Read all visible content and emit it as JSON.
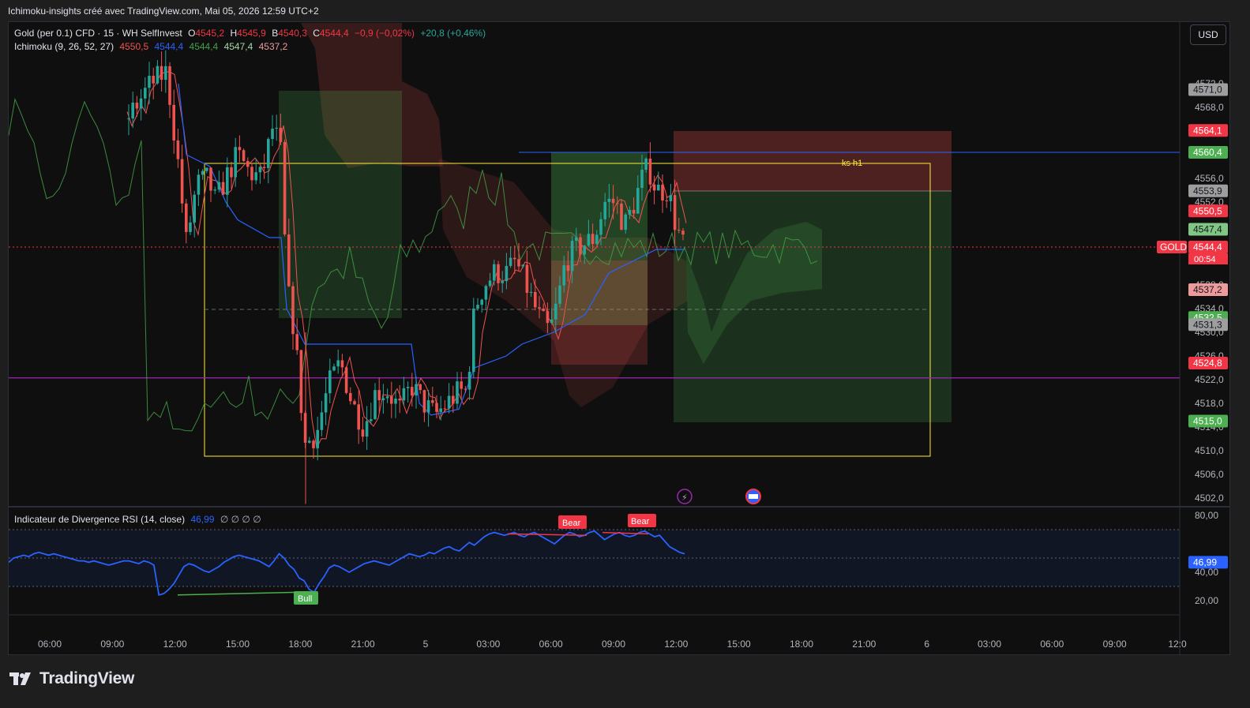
{
  "header": {
    "title": "Ichimoku-insights créé avec TradingView.com, Mai 05, 2026 12:59 UTC+2"
  },
  "currency_button": "USD",
  "legend_main": {
    "symbol": "Gold (per 0.1) CFD · 15 · WH SelfInvest",
    "o_label": "O",
    "o": "4545,2",
    "h_label": "H",
    "h": "4545,9",
    "b_label": "B",
    "b": "4540,3",
    "c_label": "C",
    "c": "4544,4",
    "chg": "−0,9 (−0,02%)",
    "chg2": "+20,8 (+0,46%)"
  },
  "legend_ichimoku": {
    "name": "Ichimoku (9, 26, 52, 27)",
    "v1": "4550,5",
    "v2": "4544,4",
    "v3": "4544,4",
    "v4": "4547,4",
    "v5": "4537,2"
  },
  "legend_rsi": {
    "name": "Indicateur de Divergence RSI (14, close)",
    "value": "46,99",
    "extra": "∅ ∅ ∅ ∅"
  },
  "annotations": {
    "ks": "ks h1",
    "bear": "Bear",
    "bull": "Bull",
    "symbol_tag": "GOLD",
    "countdown": "00:54"
  },
  "brand": "TradingView",
  "colors": {
    "up": "#26a69a",
    "down": "#ef5350",
    "tenkan": "#ef5350",
    "kijun": "#2962ff",
    "chikou": "#43a047",
    "rsi": "#2962ff",
    "purple_line": "#9c27b0",
    "box": "#ffeb3b"
  },
  "chart_data": {
    "type": "candlestick",
    "main": {
      "ylim": [
        4500,
        4576
      ],
      "y_ticks": [
        "4572,0",
        "4568,0",
        "4556,0",
        "4552,0",
        "4538,0",
        "4534,0",
        "4530,0",
        "4526,0",
        "4522,0",
        "4518,0",
        "4514,0",
        "4510,0",
        "4506,0",
        "4502,0"
      ],
      "x_ticks": [
        "06:00",
        "09:00",
        "12:00",
        "15:00",
        "18:00",
        "21:00",
        "5",
        "03:00",
        "06:00",
        "09:00",
        "12:00",
        "15:00",
        "18:00",
        "21:00",
        "6",
        "03:00",
        "06:00",
        "09:00",
        "12:0"
      ],
      "price_labels": [
        {
          "text": "4571,0",
          "color": "#9e9e9e",
          "value": 4571.0
        },
        {
          "text": "4564,1",
          "color": "#f23645",
          "value": 4564.1
        },
        {
          "text": "4560,4",
          "color": "#4caf50",
          "value": 4560.4
        },
        {
          "text": "4553,9",
          "color": "#9e9e9e",
          "value": 4553.9
        },
        {
          "text": "4550,5",
          "color": "#f23645",
          "value": 4550.5
        },
        {
          "text": "4547,4",
          "color": "#81c784",
          "value": 4547.4
        },
        {
          "text": "4544,4",
          "color": "#f23645",
          "value": 4544.4
        },
        {
          "text": "4537,2",
          "color": "#ef9a9a",
          "value": 4537.2
        },
        {
          "text": "4532,5",
          "color": "#4caf50",
          "value": 4532.5
        },
        {
          "text": "4531,3",
          "color": "#9e9e9e",
          "value": 4531.3
        },
        {
          "text": "4524,8",
          "color": "#f23645",
          "value": 4524.8
        },
        {
          "text": "4515,0",
          "color": "#4caf50",
          "value": 4515.0
        }
      ],
      "last_price": 4544.4,
      "horizontal_lines": [
        {
          "name": "ks h1",
          "value": 4560.4,
          "color": "#2962ff"
        },
        {
          "name": "purple",
          "value": 4522.3,
          "color": "#9c27b0"
        }
      ]
    },
    "rsi": {
      "ylim": [
        12,
        82
      ],
      "y_ticks": [
        "80,00",
        "40,00",
        "20,00"
      ],
      "levels": [
        70,
        50,
        30
      ],
      "last": "46,99",
      "values": [
        47,
        50,
        51,
        52,
        51,
        53,
        54,
        53,
        52,
        53,
        52,
        51,
        50,
        49,
        48,
        48,
        47,
        48,
        47,
        46,
        45,
        46,
        47,
        48,
        48,
        47,
        46,
        48,
        47,
        45,
        24,
        25,
        28,
        32,
        38,
        44,
        46,
        45,
        43,
        41,
        40,
        42,
        44,
        47,
        49,
        51,
        52,
        51,
        50,
        49,
        48,
        46,
        44,
        48,
        53,
        50,
        45,
        42,
        36,
        34,
        28,
        26,
        32,
        37,
        43,
        45,
        44,
        42,
        40,
        42,
        44,
        46,
        47,
        48,
        47,
        46,
        45,
        47,
        49,
        51,
        53,
        52,
        51,
        52,
        54,
        53,
        55,
        57,
        58,
        56,
        55,
        58,
        61,
        59,
        62,
        65,
        67,
        68,
        67,
        66,
        67,
        68,
        66,
        65,
        67,
        68,
        66,
        64,
        62,
        60,
        63,
        66,
        68,
        67,
        65,
        66,
        68,
        69,
        66,
        63,
        65,
        67,
        68,
        66,
        65,
        66,
        68,
        69,
        67,
        65,
        66,
        62,
        58,
        56,
        54,
        53
      ]
    }
  }
}
